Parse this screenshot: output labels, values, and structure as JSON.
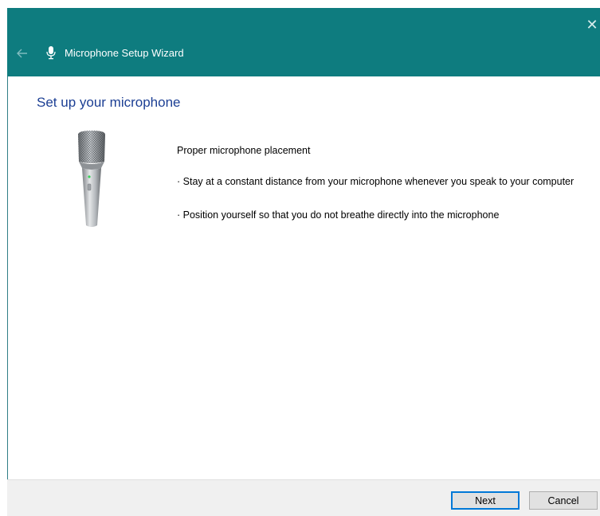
{
  "window": {
    "title": "Microphone Setup Wizard",
    "title_icon": "microphone-icon",
    "back_icon": "back-arrow-icon",
    "close_icon": "close-icon",
    "accent_color": "#0e7c7f"
  },
  "content": {
    "heading": "Set up your microphone",
    "image": "microphone-illustration",
    "info_title": "Proper microphone placement",
    "bullets": [
      "· Stay at a constant distance from your microphone whenever you speak to your computer",
      "· Position yourself so that you do not breathe directly into the microphone"
    ]
  },
  "footer": {
    "next_label": "Next",
    "cancel_label": "Cancel"
  }
}
